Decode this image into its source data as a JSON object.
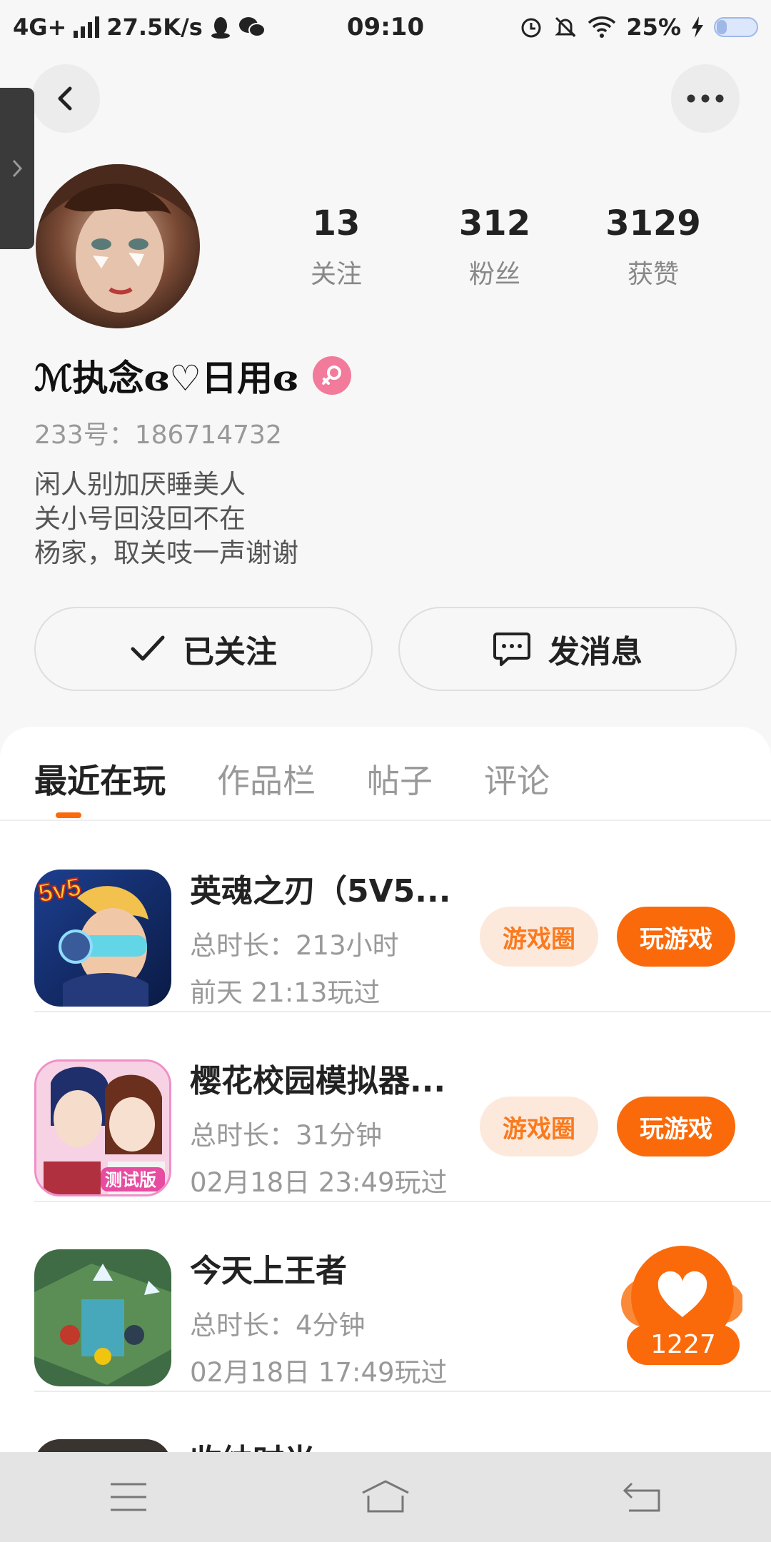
{
  "status_bar": {
    "network": "4G+",
    "speed": "27.5K/s",
    "time": "09:10",
    "battery": "25%"
  },
  "profile": {
    "stats": [
      {
        "value": "13",
        "label": "关注"
      },
      {
        "value": "312",
        "label": "粉丝"
      },
      {
        "value": "3129",
        "label": "获赞"
      }
    ],
    "username": "ℳ执念ɞ♡日用ɞ",
    "uid": "233号：186714732",
    "bio": [
      "闲人别加厌睡美人",
      "关小号回没回不在",
      "杨家，取关吱一声谢谢"
    ],
    "follow_label": "已关注",
    "message_label": "发消息"
  },
  "tabs": [
    {
      "label": "最近在玩",
      "active": true
    },
    {
      "label": "作品栏",
      "active": false
    },
    {
      "label": "帖子",
      "active": false
    },
    {
      "label": "评论",
      "active": false
    }
  ],
  "games": [
    {
      "title": "英魂之刃（5V5...",
      "duration": "总时长：213小时",
      "last_played": "前天 21:13玩过",
      "community_label": "游戏圈",
      "play_label": "玩游戏",
      "icon_text": "5v5"
    },
    {
      "title": "樱花校园模拟器...",
      "duration": "总时长：31分钟",
      "last_played": "02月18日 23:49玩过",
      "community_label": "游戏圈",
      "play_label": "玩游戏",
      "icon_text": "测试版"
    },
    {
      "title": "今天上王者",
      "duration": "总时长：4分钟",
      "last_played": "02月18日 17:49玩过"
    },
    {
      "title": "收纳时光",
      "duration": "",
      "last_played": ""
    }
  ],
  "like_bubble": {
    "count": "1227"
  },
  "colors": {
    "accent": "#fa6a0a",
    "accent_light": "#fde9dc",
    "gender": "#f27a9a"
  }
}
